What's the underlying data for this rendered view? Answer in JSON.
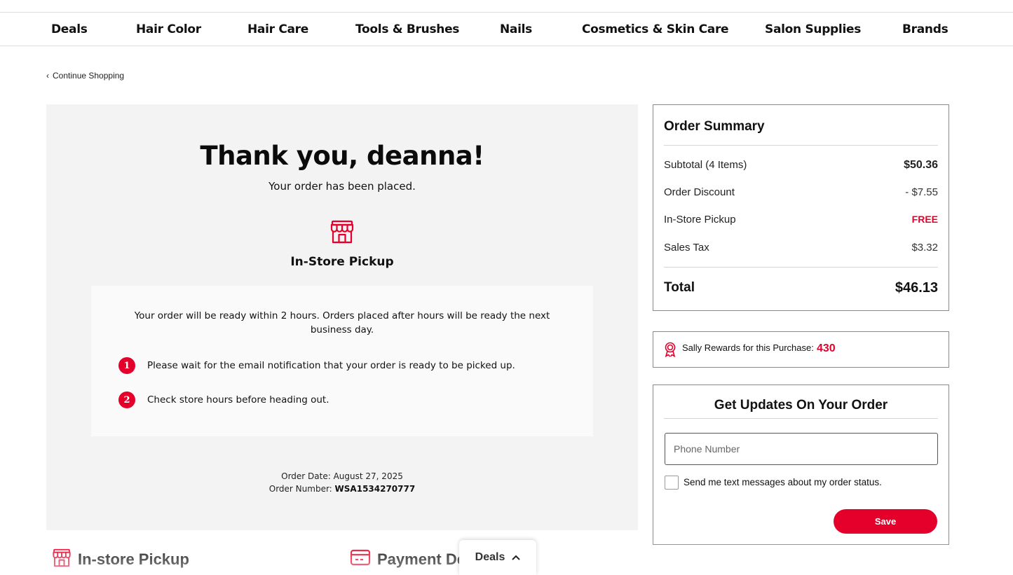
{
  "nav": {
    "items": [
      "Deals",
      "Hair Color",
      "Hair Care",
      "Tools & Brushes",
      "Nails",
      "Cosmetics & Skin Care",
      "Salon Supplies",
      "Brands"
    ]
  },
  "continue_shopping": "Continue Shopping",
  "confirmation": {
    "heading": "Thank you, deanna!",
    "subheading": "Your order has been placed.",
    "method_title": "In-Store Pickup",
    "ready_text": "Your order will be ready within 2 hours. Orders placed after hours will be ready the next business day.",
    "steps": [
      {
        "num": "1",
        "text": "Please wait for the email notification that your order is ready to be picked up."
      },
      {
        "num": "2",
        "text": "Check store hours before heading out."
      }
    ],
    "order_date_label": "Order Date: August 27, 2025",
    "order_number_label": "Order Number: ",
    "order_number": "WSA1534270777"
  },
  "summary": {
    "title": "Order Summary",
    "rows": [
      {
        "label": "Subtotal (4 Items)",
        "value": "$50.36"
      },
      {
        "label": "Order Discount",
        "value": "- $7.55"
      },
      {
        "label": "In-Store Pickup",
        "value": "FREE"
      },
      {
        "label": "Sales Tax",
        "value": "$3.32"
      }
    ],
    "total_label": "Total",
    "total_value": "$46.13"
  },
  "rewards": {
    "label": "Sally Rewards for this Purchase:",
    "value": "430"
  },
  "updates": {
    "title": "Get Updates On Your Order",
    "phone_placeholder": "Phone Number",
    "sms_label": "Send me text messages about my order status.",
    "save_label": "Save"
  },
  "sections": {
    "pickup": "In-store Pickup",
    "payment": "Payment De"
  },
  "deals_tab": "Deals",
  "colors": {
    "accent": "#e4002b",
    "panel_bg": "#f3f3f3"
  }
}
